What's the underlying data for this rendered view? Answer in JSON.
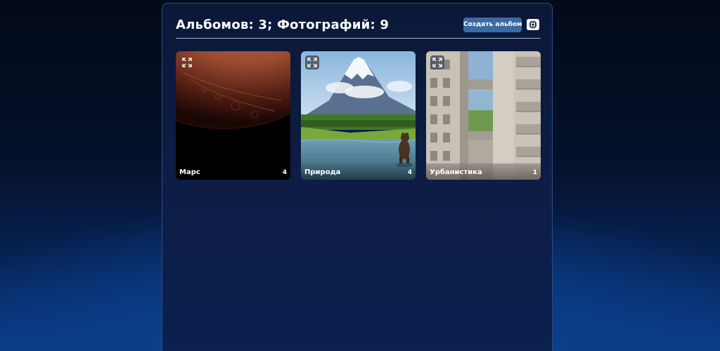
{
  "header": {
    "title": "Альбомов: 3; Фотографий: 9",
    "create_button_label": "Создать альбом",
    "settings_icon": "chip-icon"
  },
  "albums": [
    {
      "title": "Марс",
      "count": "4",
      "image": "mars-planet"
    },
    {
      "title": "Природа",
      "count": "4",
      "image": "volcano-bear-landscape"
    },
    {
      "title": "Урбанистика",
      "count": "1",
      "image": "apartment-building"
    }
  ],
  "icons": {
    "expand": "expand-icon"
  },
  "colors": {
    "button_bg": "#3c6aa3",
    "panel_border": "#2c4d86",
    "text": "#ffffff"
  }
}
